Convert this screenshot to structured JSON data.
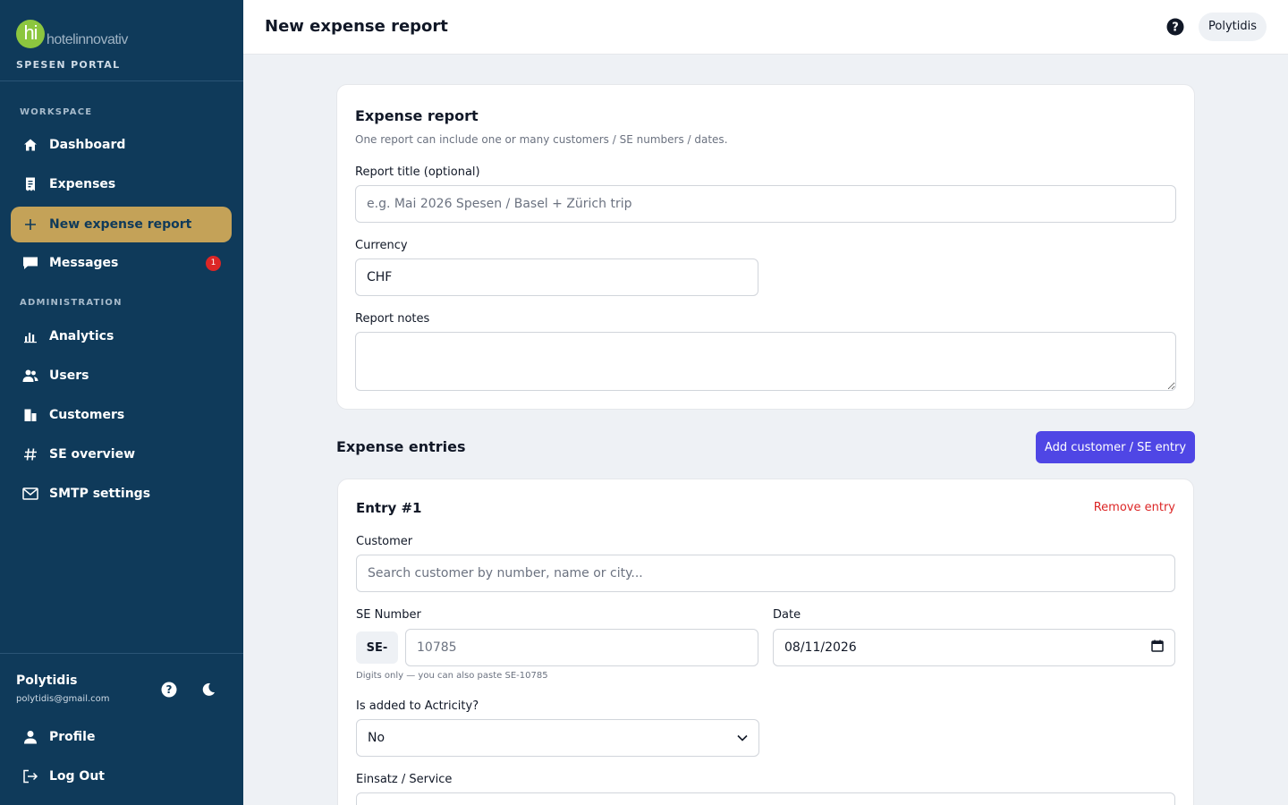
{
  "brand": {
    "logo_letters": "hi",
    "logo_name": "hotelinnovativ",
    "portal": "SPESEN PORTAL"
  },
  "sidebar": {
    "workspace_label": "WORKSPACE",
    "admin_label": "ADMINISTRATION",
    "items": [
      {
        "label": "Dashboard",
        "icon": "home-icon"
      },
      {
        "label": "Expenses",
        "icon": "receipt-icon"
      },
      {
        "label": "New expense report",
        "icon": "plus-icon",
        "active": true
      },
      {
        "label": "Messages",
        "icon": "chat-icon",
        "badge": "1"
      }
    ],
    "admin_items": [
      {
        "label": "Analytics",
        "icon": "bar-chart-icon"
      },
      {
        "label": "Users",
        "icon": "users-icon"
      },
      {
        "label": "Customers",
        "icon": "building-icon"
      },
      {
        "label": "SE overview",
        "icon": "hash-icon"
      },
      {
        "label": "SMTP settings",
        "icon": "mail-icon"
      }
    ],
    "footer": {
      "user_name": "Polytidis",
      "user_email": "polytidis@gmail.com",
      "profile_label": "Profile",
      "logout_label": "Log Out"
    },
    "colors": {
      "bg": "#0f3a5a",
      "active": "#c4a258"
    }
  },
  "header": {
    "title": "New expense report",
    "user": "Polytidis"
  },
  "report": {
    "title": "Expense report",
    "subtitle": "One report can include one or many customers / SE numbers / dates.",
    "title_label": "Report title (optional)",
    "title_placeholder": "e.g. Mai 2026 Spesen / Basel + Zürich trip",
    "currency_label": "Currency",
    "currency_value": "CHF",
    "notes_label": "Report notes"
  },
  "entries": {
    "heading": "Expense entries",
    "add_button": "Add customer / SE entry",
    "entry": {
      "title": "Entry #1",
      "remove": "Remove entry",
      "customer_label": "Customer",
      "customer_placeholder": "Search customer by number, name or city...",
      "se_label": "SE Number",
      "se_prefix": "SE-",
      "se_placeholder": "10785",
      "se_hint": "Digits only — you can also paste SE-10785",
      "date_label": "Date",
      "date_value": "08/11/2026",
      "activity_label": "Is added to Actricity?",
      "activity_value": "No",
      "service_label": "Einsatz / Service"
    }
  },
  "accent_color": "#4f46e5"
}
